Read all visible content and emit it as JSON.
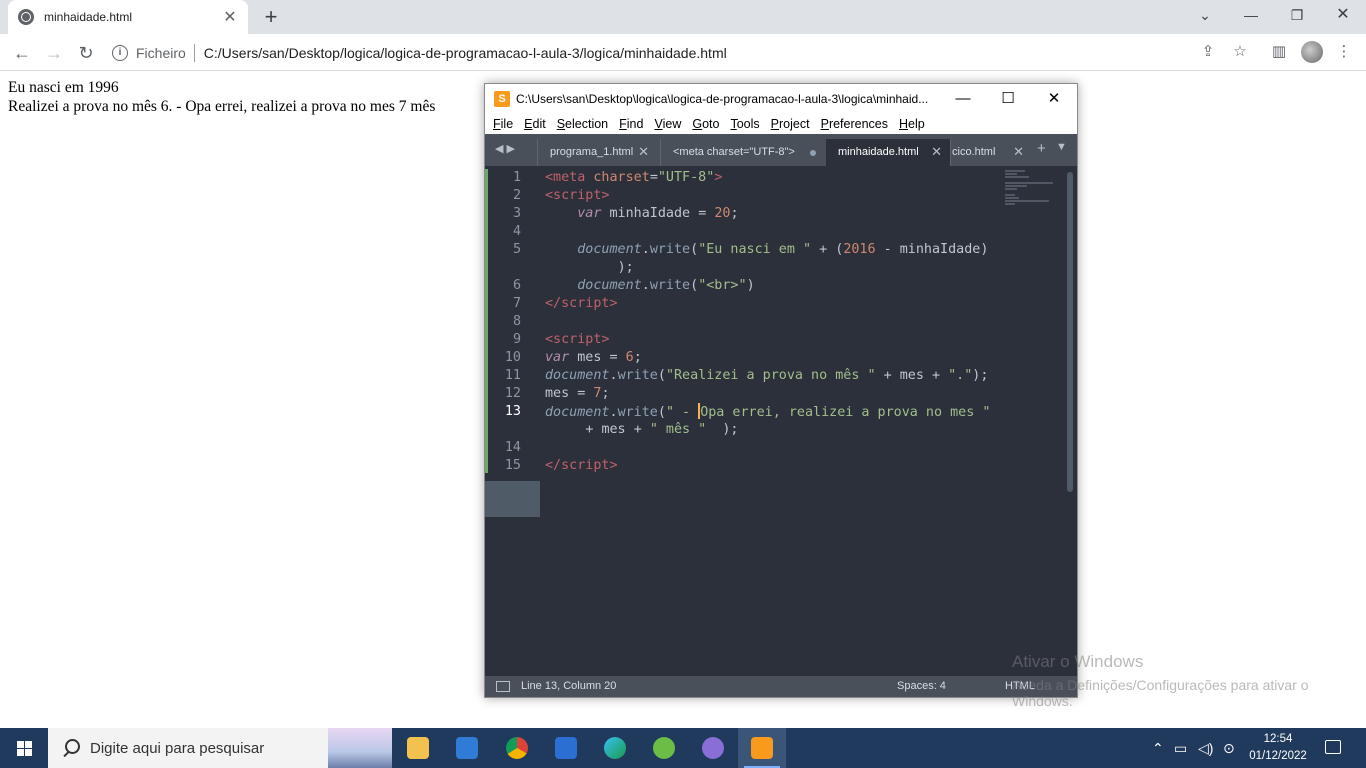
{
  "browser": {
    "tab_title": "minhaidade.html",
    "address_chip": "Ficheiro",
    "address": "C:/Users/san/Desktop/logica/logica-de-programacao-l-aula-3/logica/minhaidade.html",
    "icons": [
      "back-icon",
      "forward-icon",
      "reload-icon",
      "info-icon",
      "share-icon",
      "star-icon",
      "sidepanel-icon",
      "avatar",
      "menu-icon"
    ]
  },
  "page": {
    "line1": "Eu nasci em 1996",
    "line2": "Realizei a prova no mês 6. - Opa errei, realizei a prova no mes 7 mês"
  },
  "sublime": {
    "title": "C:\\Users\\san\\Desktop\\logica\\logica-de-programacao-l-aula-3\\logica\\minhaid...",
    "menu": [
      "File",
      "Edit",
      "Selection",
      "Find",
      "View",
      "Goto",
      "Tools",
      "Project",
      "Preferences",
      "Help"
    ],
    "tabs": [
      {
        "label": "programa_1.html"
      },
      {
        "label": "<meta charset=\"UTF-8\">"
      },
      {
        "label": "minhaidade.html"
      },
      {
        "label": "cico.html"
      }
    ],
    "line_numbers": [
      "1",
      "2",
      "3",
      "4",
      "5",
      "6",
      "7",
      "8",
      "9",
      "10",
      "11",
      "12",
      "13",
      "14",
      "15"
    ],
    "status": {
      "position": "Line 13, Column 20",
      "spaces": "Spaces: 4",
      "syntax": "HTML"
    },
    "accent": "#f89b1c",
    "editor_bg": "#2b303b"
  },
  "watermark": {
    "line1": "Ativar o Windows",
    "line2": "Aceda a Definições/Configurações para ativar o Windows."
  },
  "taskbar": {
    "search_placeholder": "Digite aqui para pesquisar",
    "time": "12:54",
    "date": "01/12/2022",
    "apps": [
      "file-explorer-icon",
      "store-icon",
      "chrome-icon",
      "mail-icon",
      "edge-icon",
      "utorrent-icon",
      "discord-icon",
      "sublime-icon"
    ]
  }
}
